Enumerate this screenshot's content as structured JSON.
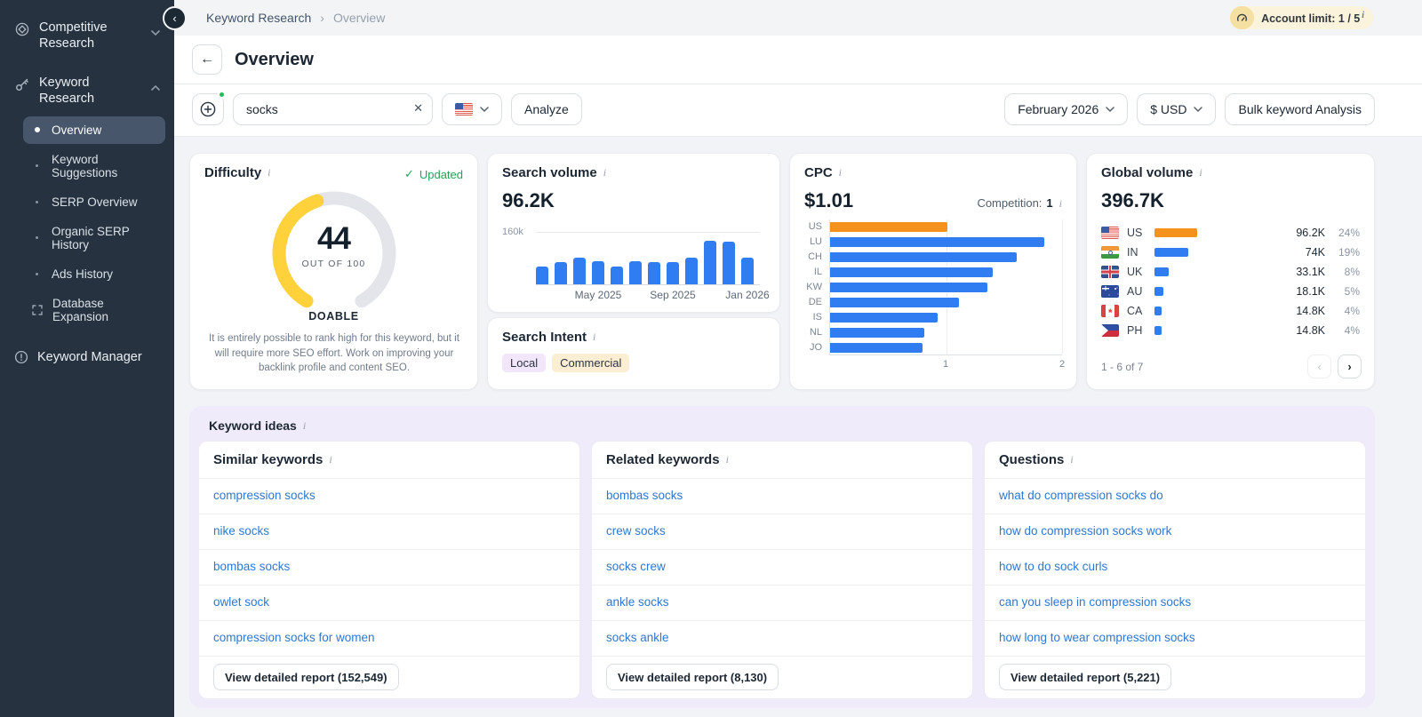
{
  "colors": {
    "accent_blue": "#2F7DF0",
    "link_blue": "#2E77D0",
    "highlight_orange": "#F5921E",
    "gauge_yellow": "#FFD23B",
    "success_green": "#23A455",
    "sidebar_bg": "#26323F",
    "ideas_lavender": "#EFEBFA",
    "limit_badge_bg": "#FBF3DC"
  },
  "sidebar": {
    "sections": [
      {
        "label": "Competitive Research",
        "icon": "target-icon",
        "chevron": "down"
      },
      {
        "label": "Keyword Research",
        "icon": "key-icon",
        "chevron": "up"
      }
    ],
    "keyword_research_items": [
      {
        "label": "Overview",
        "active": true
      },
      {
        "label": "Keyword Suggestions"
      },
      {
        "label": "SERP Overview"
      },
      {
        "label": "Organic SERP History"
      },
      {
        "label": "Ads History"
      },
      {
        "label": "Database Expansion",
        "icon": "expand-icon"
      }
    ],
    "bottom": {
      "label": "Keyword Manager",
      "icon": "circle-exclamation-icon"
    }
  },
  "topbar": {
    "breadcrumb": {
      "parent": "Keyword Research",
      "current": "Overview"
    },
    "account_limit": {
      "label": "Account limit:",
      "value": "1 / 5"
    }
  },
  "page": {
    "title": "Overview"
  },
  "toolbar": {
    "keyword_value": "socks",
    "country_flag": "US",
    "analyze": "Analyze",
    "period": "February 2026",
    "currency": "$ USD",
    "bulk": "Bulk keyword Analysis"
  },
  "difficulty": {
    "title": "Difficulty",
    "updated": "Updated",
    "value": "44",
    "out_of": "OUT OF 100",
    "verdict": "DOABLE",
    "description": "It is entirely possible to rank high for this keyword, but it will require more SEO effort. Work on improving your backlink profile and content SEO."
  },
  "search_volume": {
    "title": "Search volume",
    "value": "96.2K",
    "ytick": "160k"
  },
  "search_intent": {
    "title": "Search Intent",
    "badges": [
      "Local",
      "Commercial"
    ]
  },
  "cpc": {
    "title": "CPC",
    "value": "$1.01",
    "competition_label": "Competition:",
    "competition_value": "1"
  },
  "global_volume": {
    "title": "Global volume",
    "value": "396.7K",
    "rows": [
      {
        "country": "US",
        "volume": "96.2K",
        "percent": "24%",
        "share": 24,
        "color": "#F5921E"
      },
      {
        "country": "IN",
        "volume": "74K",
        "percent": "19%",
        "share": 19
      },
      {
        "country": "UK",
        "volume": "33.1K",
        "percent": "8%",
        "share": 8
      },
      {
        "country": "AU",
        "volume": "18.1K",
        "percent": "5%",
        "share": 5
      },
      {
        "country": "CA",
        "volume": "14.8K",
        "percent": "4%",
        "share": 4
      },
      {
        "country": "PH",
        "volume": "14.8K",
        "percent": "4%",
        "share": 4
      }
    ],
    "pagination": "1 - 6 of 7"
  },
  "keyword_ideas": {
    "title": "Keyword ideas",
    "columns": [
      {
        "title": "Similar keywords",
        "items": [
          "compression socks",
          "nike socks",
          "bombas socks",
          "owlet sock",
          "compression socks for women"
        ],
        "report": "View detailed report (152,549)"
      },
      {
        "title": "Related keywords",
        "items": [
          "bombas socks",
          "crew socks",
          "socks crew",
          "ankle socks",
          "socks ankle"
        ],
        "report": "View detailed report (8,130)"
      },
      {
        "title": "Questions",
        "items": [
          "what do compression socks do",
          "how do compression socks work",
          "how to do sock curls",
          "can you sleep in compression socks",
          "how long to wear compression socks"
        ],
        "report": "View detailed report (5,221)"
      }
    ]
  },
  "chart_data": [
    {
      "type": "bar",
      "title": "Search volume trend",
      "x": [
        "Feb 2025",
        "Mar 2025",
        "Apr 2025",
        "May 2025",
        "Jun 2025",
        "Jul 2025",
        "Aug 2025",
        "Sep 2025",
        "Oct 2025",
        "Nov 2025",
        "Dec 2025",
        "Jan 2026"
      ],
      "values": [
        54000,
        66000,
        81000,
        68000,
        54000,
        68000,
        66000,
        66000,
        81000,
        130000,
        129000,
        81000
      ],
      "ylim": [
        0,
        160000
      ],
      "visible_x_labels": [
        "May 2025",
        "Sep 2025",
        "Jan 2026"
      ],
      "visible_y_label": "160k",
      "bar_color": "#2F7DF0",
      "grid": "top-line-only",
      "legend": false
    },
    {
      "type": "bar",
      "orientation": "horizontal",
      "title": "CPC by country",
      "categories": [
        "US",
        "LU",
        "CH",
        "IL",
        "KW",
        "DE",
        "IS",
        "NL",
        "JO"
      ],
      "values": [
        1.01,
        1.85,
        1.61,
        1.4,
        1.36,
        1.11,
        0.93,
        0.81,
        0.8
      ],
      "xlim": [
        0,
        2
      ],
      "xticks": [
        "1",
        "2"
      ],
      "bar_color": "#2F7DF0",
      "highlight_category": "US",
      "highlight_color": "#F5921E",
      "legend": false
    }
  ]
}
